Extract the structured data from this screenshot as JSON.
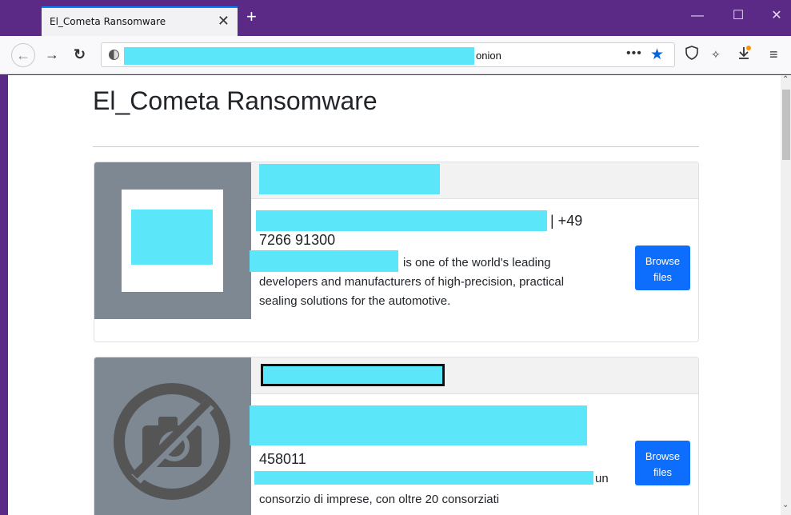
{
  "browser": {
    "tab_title": "El_Cometa Ransomware",
    "tab_close": "✕",
    "new_tab": "+",
    "url_suffix": "onion",
    "url_more": "•••",
    "window_controls": {
      "minimize": "—",
      "maximize": "☐",
      "close": "✕"
    },
    "icons": [
      "back-icon",
      "forward-icon",
      "reload-icon",
      "site-info-icon",
      "bookmark-star-icon",
      "shield-icon",
      "extension-icon",
      "download-icon",
      "menu-icon"
    ]
  },
  "page": {
    "title": "El_Cometa Ransomware",
    "cards": [
      {
        "phone_suffix": "| +49",
        "phone_line2": "7266 91300",
        "desc_line1": "is one of the world's leading",
        "desc_line2": "developers and manufacturers of high-precision, practical",
        "desc_line3": "sealing solutions for the automotive.",
        "button": "Browse files"
      },
      {
        "phone_line2": "458011",
        "desc_line1": "un",
        "desc_line2": "consorzio di imprese, con oltre 20 consorziati",
        "button": "Browse files"
      }
    ]
  },
  "colors": {
    "titlebar": "#5b2a86",
    "accent": "#0d6efd",
    "redaction": "#5ce6fa"
  }
}
